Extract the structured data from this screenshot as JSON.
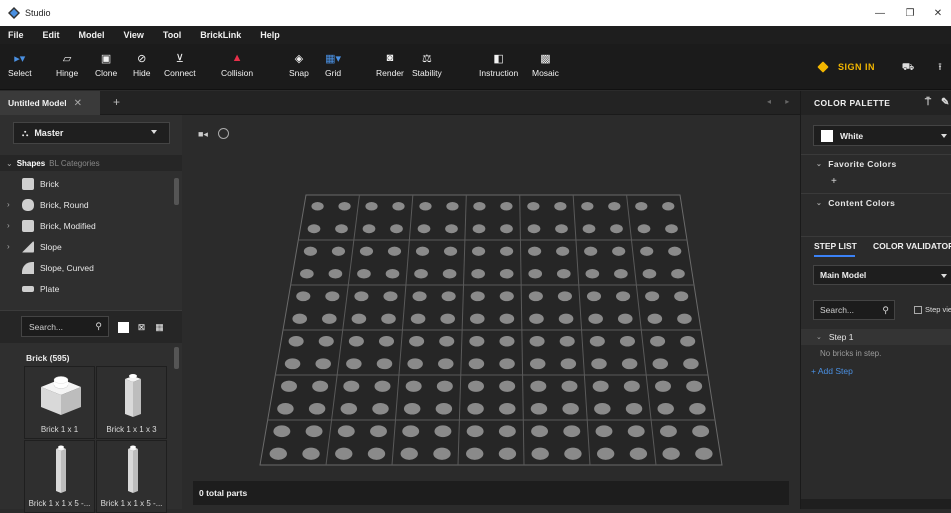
{
  "window": {
    "title": "Studio",
    "controls": [
      "—",
      "❐",
      "✕"
    ]
  },
  "menu": [
    "File",
    "Edit",
    "Model",
    "View",
    "Tool",
    "BrickLink",
    "Help"
  ],
  "toolbar": {
    "tools": [
      {
        "label": "Select",
        "icon": "select-arrow-icon",
        "glyph": "▸▾"
      },
      {
        "label": "Hinge",
        "icon": "hinge-icon",
        "glyph": "⏥"
      },
      {
        "label": "Clone",
        "icon": "clone-icon",
        "glyph": "▣"
      },
      {
        "label": "Hide",
        "icon": "hide-eye-icon",
        "glyph": "⊘"
      },
      {
        "label": "Connect",
        "icon": "connect-icon",
        "glyph": "⊻"
      },
      {
        "label": "Collision",
        "icon": "collision-triangle-icon",
        "glyph": "▲"
      },
      {
        "label": "Snap",
        "icon": "snap-icon",
        "glyph": "◈"
      },
      {
        "label": "Grid",
        "icon": "grid-icon",
        "glyph": "▦▾"
      },
      {
        "label": "Render",
        "icon": "render-icon",
        "glyph": "◙"
      },
      {
        "label": "Stability",
        "icon": "stability-icon",
        "glyph": "⚖"
      },
      {
        "label": "Instruction",
        "icon": "instruction-icon",
        "glyph": "◧"
      },
      {
        "label": "Mosaic",
        "icon": "mosaic-icon",
        "glyph": "▩"
      }
    ],
    "collision_color": "#e8304a",
    "sign_in": "SIGN IN",
    "sign_in_color": "#f2b600"
  },
  "tabs": {
    "active": "Untitled Model",
    "close": "✕",
    "add": "+",
    "arrows": "◂ ▸"
  },
  "left_panel": {
    "master": "Master",
    "shapes_label": "Shapes",
    "bl_categories": "BL Categories",
    "categories": [
      {
        "label": "Brick",
        "expandable": false
      },
      {
        "label": "Brick, Round",
        "expandable": true
      },
      {
        "label": "Brick, Modified",
        "expandable": true
      },
      {
        "label": "Slope",
        "expandable": true
      },
      {
        "label": "Slope, Curved",
        "expandable": false
      },
      {
        "label": "Plate",
        "expandable": false
      }
    ],
    "search_placeholder": "Search...",
    "brick_count": "Brick (595)",
    "parts": [
      "Brick 1 x 1",
      "Brick 1 x 1 x 3",
      "Brick 1 x 1 x 5 -...",
      "Brick 1 x 1 x 5 -..."
    ]
  },
  "viewport": {
    "status": "0 total parts"
  },
  "right_panel": {
    "title": "COLOR PALETTE",
    "selected_color": "White",
    "selected_color_hex": "#ffffff",
    "favorite_colors": "Favorite Colors",
    "content_colors": "Content Colors",
    "add_favorite": "+",
    "tab_step_list": "STEP LIST",
    "tab_color_validator": "COLOR VALIDATOR",
    "model": "Main Model",
    "search_placeholder": "Search...",
    "step_view": "Step vie",
    "step": "Step 1",
    "no_bricks": "No bricks in step.",
    "add_step": "+ Add Step"
  }
}
